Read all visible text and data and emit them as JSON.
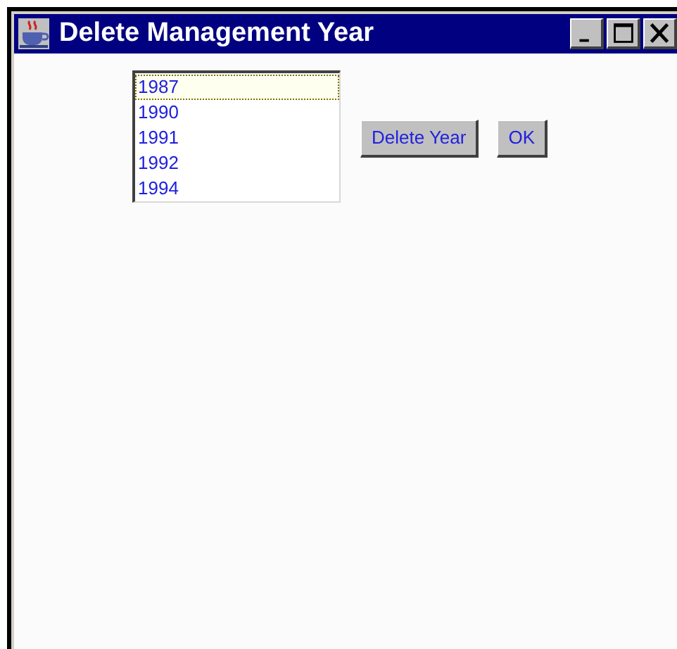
{
  "window": {
    "title": "Delete Management Year",
    "controls": [
      {
        "kind": "minimize"
      },
      {
        "kind": "maximize"
      },
      {
        "kind": "close"
      }
    ]
  },
  "year_list": {
    "items": [
      {
        "label": "1987",
        "focused": true
      },
      {
        "label": "1990",
        "focused": false
      },
      {
        "label": "1991",
        "focused": false
      },
      {
        "label": "1992",
        "focused": false
      },
      {
        "label": "1994",
        "focused": false
      }
    ]
  },
  "buttons": [
    {
      "label": "Delete Year"
    },
    {
      "label": "OK"
    }
  ]
}
